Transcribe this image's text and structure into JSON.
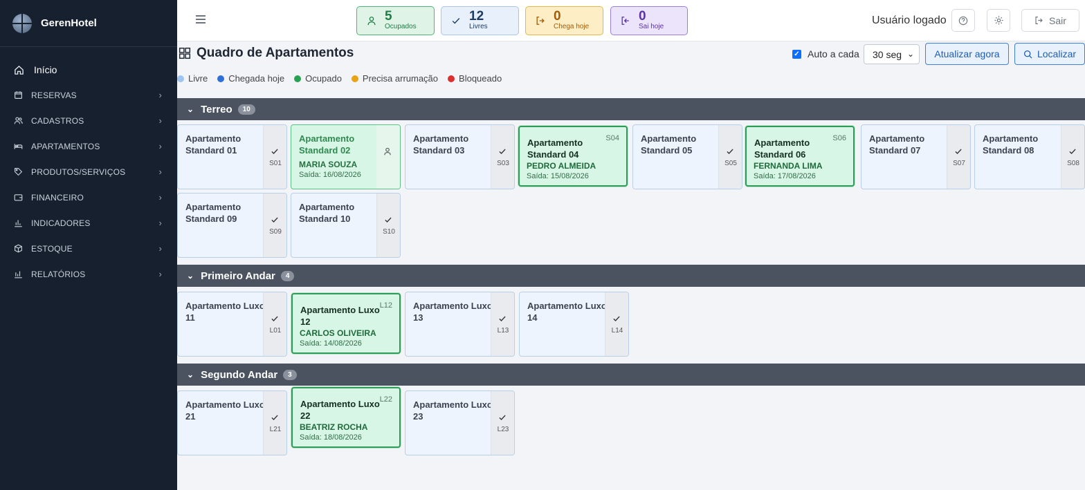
{
  "app": {
    "name": "GerenHotel"
  },
  "nav": {
    "home": "Início",
    "items": [
      {
        "label": "RESERVAS",
        "icon": "calendar-icon"
      },
      {
        "label": "CADASTROS",
        "icon": "users-icon"
      },
      {
        "label": "APARTAMENTOS",
        "icon": "bed-icon"
      },
      {
        "label": "PRODUTOS/SERVIÇOS",
        "icon": "tag-icon"
      },
      {
        "label": "FINANCEIRO",
        "icon": "wallet-icon"
      },
      {
        "label": "INDICADORES",
        "icon": "bar-chart-icon"
      },
      {
        "label": "ESTOQUE",
        "icon": "box-icon"
      },
      {
        "label": "RELATÓRIOS",
        "icon": "report-icon"
      }
    ]
  },
  "stats": {
    "occupied": {
      "value": "5",
      "label": "Ocupados"
    },
    "free": {
      "value": "12",
      "label": "Livres"
    },
    "arrivals": {
      "value": "0",
      "label": "Chega hoje"
    },
    "departures": {
      "value": "0",
      "label": "Sai hoje"
    }
  },
  "topbar": {
    "user": "Usuário logado",
    "logout": "Sair"
  },
  "page": {
    "title": "Quadro de Apartamentos",
    "auto_label": "Auto a cada",
    "interval": "30 seg",
    "refresh": "Atualizar agora",
    "search": "Localizar"
  },
  "legend": [
    {
      "label": "Livre",
      "color": "#9ec5f0"
    },
    {
      "label": "Chegada hoje",
      "color": "#2f6fd6"
    },
    {
      "label": "Ocupado",
      "color": "#27a350"
    },
    {
      "label": "Precisa arrumação",
      "color": "#e8a317"
    },
    {
      "label": "Bloqueado",
      "color": "#dc3030"
    }
  ],
  "sections": {
    "terreo": {
      "name": "Terreo",
      "count": "10"
    },
    "primeiro": {
      "name": "Primeiro Andar",
      "count": "4"
    },
    "segundo": {
      "name": "Segundo Andar",
      "count": "3"
    }
  },
  "rooms": {
    "s01": {
      "name": "Apartamento Standard 01",
      "code": "S01",
      "status": "free"
    },
    "s02": {
      "name": "Apartamento Standard 02",
      "code": "",
      "status": "arrival",
      "guest": "MARIA SOUZA",
      "checkout": "Saída: 16/08/2026"
    },
    "s03": {
      "name": "Apartamento Standard 03",
      "code": "S03",
      "status": "free"
    },
    "s04": {
      "name": "Apartamento Standard 04",
      "code": "S04",
      "status": "occupied",
      "guest": "PEDRO ALMEIDA",
      "checkout": "Saída: 15/08/2026"
    },
    "s05": {
      "name": "Apartamento Standard 05",
      "code": "S05",
      "status": "free"
    },
    "s06": {
      "name": "Apartamento Standard 06",
      "code": "S06",
      "status": "occupied",
      "guest": "FERNANDA LIMA",
      "checkout": "Saída: 17/08/2026"
    },
    "s07": {
      "name": "Apartamento Standard 07",
      "code": "S07",
      "status": "free"
    },
    "s08": {
      "name": "Apartamento Standard 08",
      "code": "S08",
      "status": "free"
    },
    "s09": {
      "name": "Apartamento Standard 09",
      "code": "S09",
      "status": "free"
    },
    "s10": {
      "name": "Apartamento Standard 10",
      "code": "S10",
      "status": "free"
    },
    "l11": {
      "name": "Apartamento Luxo 11",
      "code": "L01",
      "status": "free"
    },
    "l12": {
      "name": "Apartamento Luxo 12",
      "code": "L12",
      "status": "occupied",
      "guest": "CARLOS OLIVEIRA",
      "checkout": "Saída: 14/08/2026"
    },
    "l13": {
      "name": "Apartamento Luxo 13",
      "code": "L13",
      "status": "free"
    },
    "l14": {
      "name": "Apartamento Luxo 14",
      "code": "L14",
      "status": "free"
    },
    "l21": {
      "name": "Apartamento Luxo 21",
      "code": "L21",
      "status": "free"
    },
    "l22": {
      "name": "Apartamento Luxo 22",
      "code": "L22",
      "status": "occupied",
      "guest": "BEATRIZ ROCHA",
      "checkout": "Saída: 18/08/2026"
    },
    "l23": {
      "name": "Apartamento Luxo 23",
      "code": "L23",
      "status": "free"
    }
  }
}
